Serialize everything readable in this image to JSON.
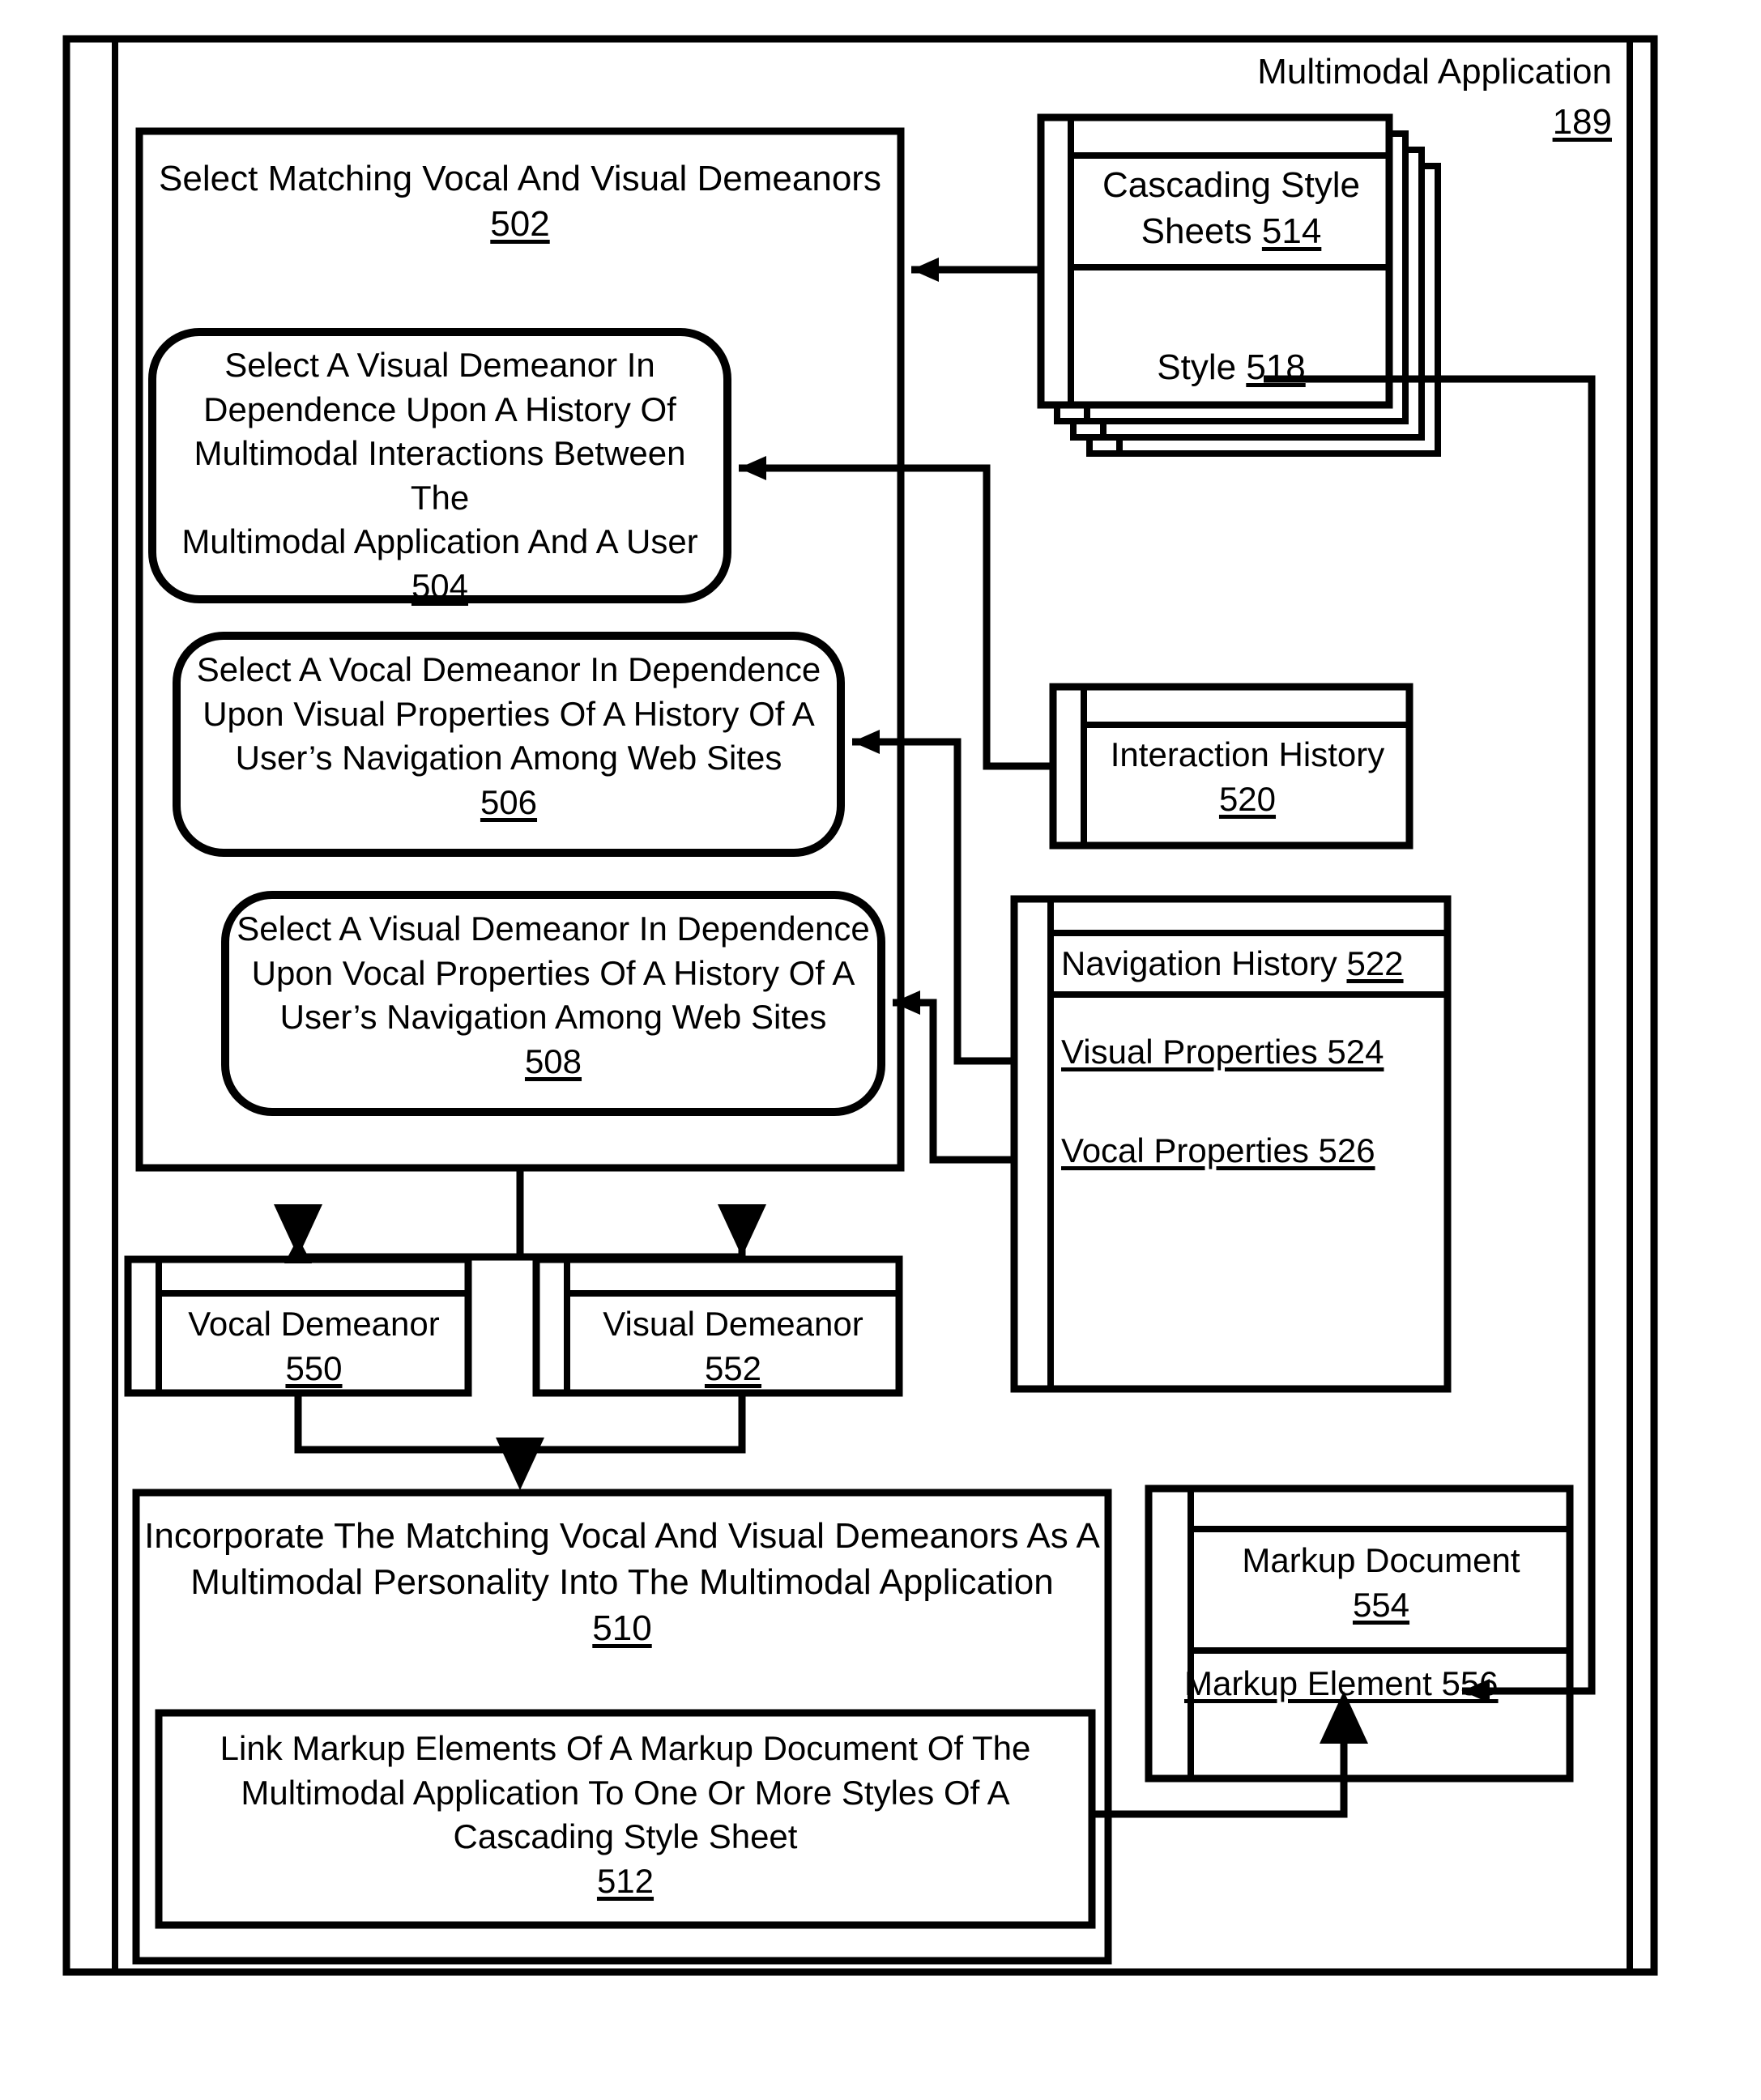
{
  "figure": {
    "outer_frame_title": "Multimodal Application",
    "outer_frame_ref": "189"
  },
  "process_boxes": [
    {
      "id": "502",
      "text": "Select Matching Vocal And Visual Demeanors",
      "ref": "502",
      "shape": "rectangle"
    },
    {
      "id": "504",
      "text": "Select A Visual Demeanor In Dependence Upon A History Of Multimodal Interactions Between The Multimodal Application And A User",
      "ref": "504",
      "shape": "rounded-rectangle"
    },
    {
      "id": "506",
      "text": "Select A Vocal Demeanor In Dependence Upon Visual Properties Of A History Of A User’s Navigation Among Web Sites",
      "ref": "506",
      "shape": "rounded-rectangle"
    },
    {
      "id": "508",
      "text": "Select A Visual Demeanor In Dependence Upon Vocal Properties Of A History Of A User’s Navigation Among Web Sites",
      "ref": "508",
      "shape": "rounded-rectangle"
    },
    {
      "id": "510",
      "text": "Incorporate The Matching Vocal And Visual Demeanors As A Multimodal Personality Into The Multimodal Application",
      "ref": "510",
      "shape": "rectangle"
    },
    {
      "id": "512",
      "text": "Link Markup Elements Of A Markup Document Of The Multimodal Application To One Or More Styles Of A Cascading Style Sheet",
      "ref": "512",
      "shape": "rectangle"
    }
  ],
  "data_objects": [
    {
      "id": "514",
      "title": "Cascading Style",
      "title2": "Sheets",
      "ref": "514",
      "shape": "stacked-document",
      "child_label": "Style",
      "child_ref": "518"
    },
    {
      "id": "520",
      "title": "Interaction History",
      "ref": "520",
      "shape": "document"
    },
    {
      "id": "522",
      "title": "Navigation History",
      "ref": "522",
      "shape": "document",
      "items": [
        {
          "label": "Visual Properties",
          "ref": "524"
        },
        {
          "label": "Vocal Properties",
          "ref": "526"
        }
      ]
    },
    {
      "id": "550",
      "title": "Vocal Demeanor",
      "ref": "550",
      "shape": "document"
    },
    {
      "id": "552",
      "title": "Visual Demeanor",
      "ref": "552",
      "shape": "document"
    },
    {
      "id": "554",
      "title": "Markup Document",
      "ref": "554",
      "shape": "document",
      "child_label": "Markup Element",
      "child_ref": "556"
    }
  ],
  "labels": {
    "b502_line1": "Select Matching Vocal And Visual Demeanors",
    "b502_ref": "502",
    "b504_l1": "Select A Visual Demeanor In",
    "b504_l2": "Dependence Upon A History Of",
    "b504_l3": "Multimodal Interactions Between The",
    "b504_l4": "Multimodal Application And A User",
    "b504_ref": "504",
    "b506_l1": "Select A Vocal Demeanor In Dependence",
    "b506_l2": "Upon Visual Properties Of A History Of A",
    "b506_l3": "User’s Navigation Among Web Sites",
    "b506_ref": "506",
    "b508_l1": "Select A Visual Demeanor In Dependence",
    "b508_l2": "Upon Vocal Properties Of A History Of A",
    "b508_l3": "User’s Navigation Among Web Sites",
    "b508_ref": "508",
    "b510_l1": "Incorporate The Matching Vocal And Visual Demeanors As A",
    "b510_l2": "Multimodal Personality Into The Multimodal Application",
    "b510_ref": "510",
    "b512_l1": "Link Markup Elements Of A Markup Document Of The",
    "b512_l2": "Multimodal Application To One Or More Styles Of A",
    "b512_l3": "Cascading Style Sheet",
    "b512_ref": "512",
    "css_l1": "Cascading Style",
    "css_l2_text": "Sheets ",
    "css_l2_ref": "514",
    "style_text": "Style ",
    "style_ref": "518",
    "inter_hist": "Interaction History",
    "inter_hist_ref": "520",
    "nav_hist_text": "Navigation History ",
    "nav_hist_ref": "522",
    "visual_props": "Visual Properties 524",
    "vocal_props": "Vocal Properties 526",
    "vocal_dem": "Vocal Demeanor",
    "vocal_dem_ref": "550",
    "visual_dem": "Visual Demeanor",
    "visual_dem_ref": "552",
    "markup_doc": "Markup Document",
    "markup_doc_ref": "554",
    "markup_el": "Markup Element 556",
    "frame_title": "Multimodal Application",
    "frame_ref": "189"
  },
  "colors": {
    "stroke": "#000000",
    "fill": "#ffffff"
  }
}
